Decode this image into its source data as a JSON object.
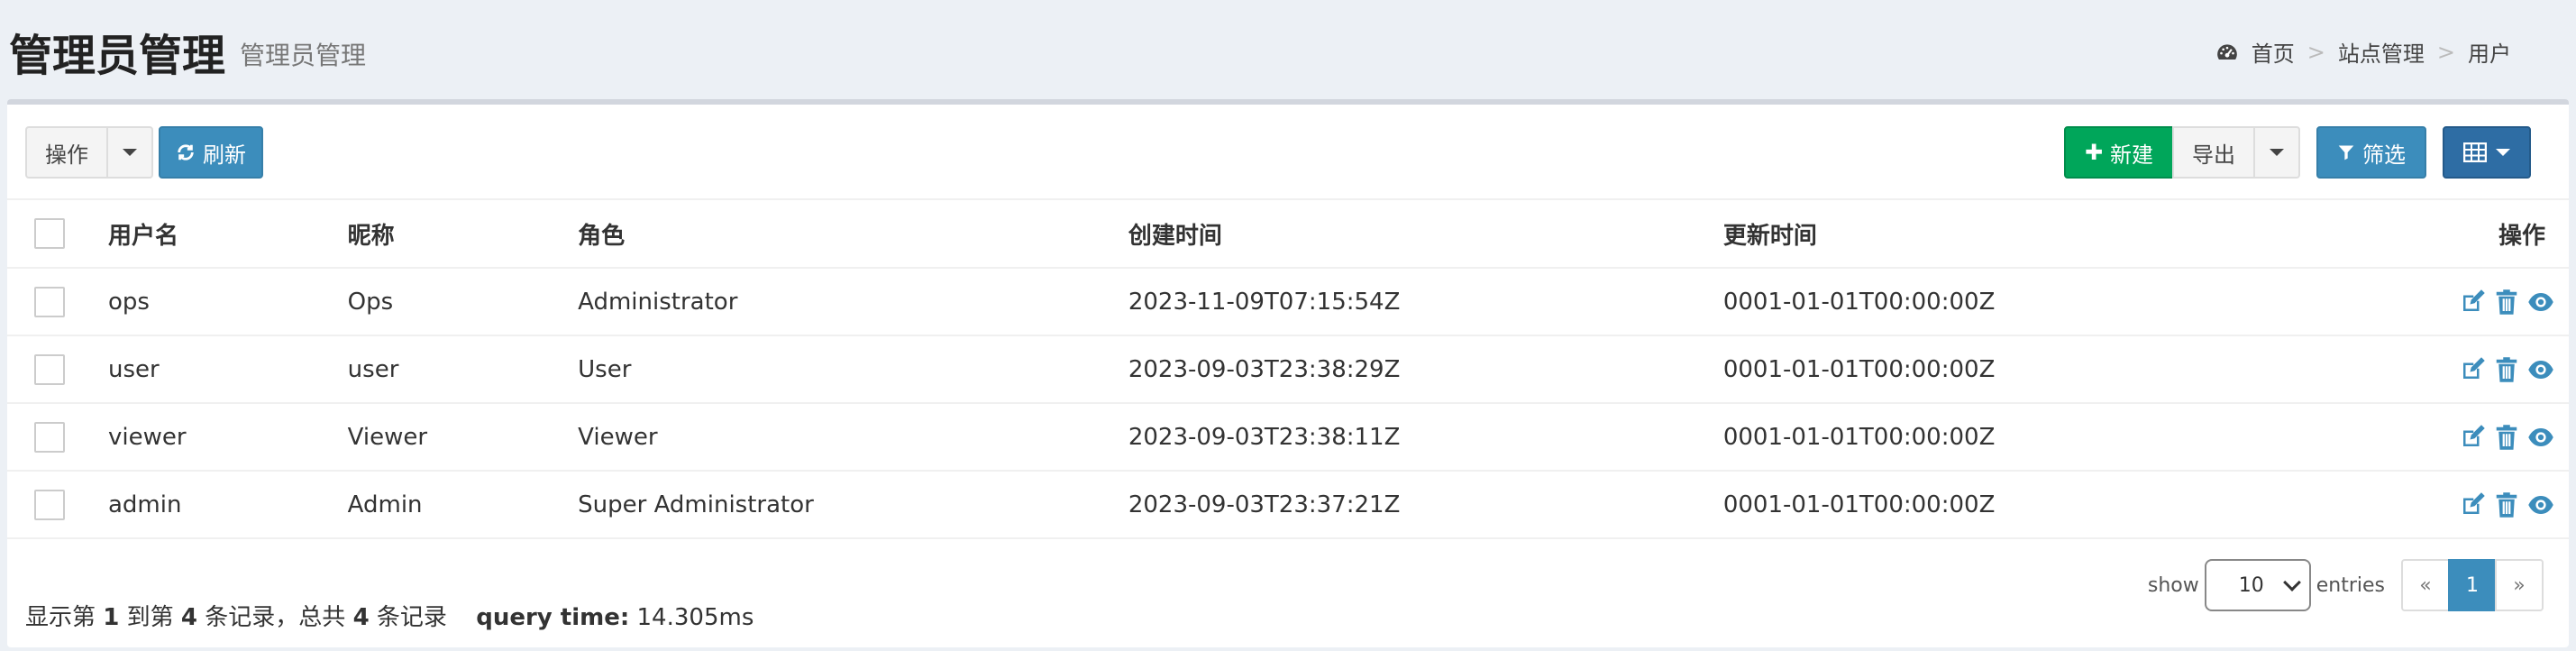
{
  "header": {
    "title": "管理员管理",
    "subtitle": "管理员管理",
    "breadcrumb": [
      "首页",
      "站点管理",
      "用户"
    ],
    "breadcrumb_sep": ">"
  },
  "toolbar": {
    "action_label": "操作",
    "refresh_label": "刷新",
    "new_label": "新建",
    "export_label": "导出",
    "filter_label": "筛选"
  },
  "table": {
    "columns": [
      "用户名",
      "昵称",
      "角色",
      "创建时间",
      "更新时间",
      "操作"
    ],
    "rows": [
      {
        "username": "ops",
        "nickname": "Ops",
        "role": "Administrator",
        "created": "2023-11-09T07:15:54Z",
        "updated": "0001-01-01T00:00:00Z"
      },
      {
        "username": "user",
        "nickname": "user",
        "role": "User",
        "created": "2023-09-03T23:38:29Z",
        "updated": "0001-01-01T00:00:00Z"
      },
      {
        "username": "viewer",
        "nickname": "Viewer",
        "role": "Viewer",
        "created": "2023-09-03T23:38:11Z",
        "updated": "0001-01-01T00:00:00Z"
      },
      {
        "username": "admin",
        "nickname": "Admin",
        "role": "Super Administrator",
        "created": "2023-09-03T23:37:21Z",
        "updated": "0001-01-01T00:00:00Z"
      }
    ],
    "row_action_icons": [
      "edit-icon",
      "trash-icon",
      "eye-icon"
    ]
  },
  "footer": {
    "text1": "显示第",
    "from": "1",
    "text2": "到第",
    "to": "4",
    "text3": "条记录，总共",
    "total": "4",
    "text4": "条记录",
    "query_time_label": "query time:",
    "query_time_value": "14.305ms"
  },
  "pagination": {
    "show_label": "show",
    "entries_label": "entries",
    "per_page": "10",
    "prev": "«",
    "current": "1",
    "next": "»"
  },
  "colors": {
    "primary": "#3c8dbc",
    "success": "#00a65a",
    "icon": "#3c8dbc"
  }
}
